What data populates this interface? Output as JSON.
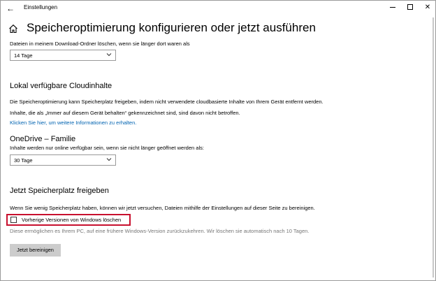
{
  "window": {
    "title": "Einstellungen",
    "back_glyph": "←",
    "minimize_label": "",
    "close_glyph": "✕"
  },
  "page": {
    "title": "Speicheroptimierung konfigurieren oder jetzt ausführen"
  },
  "downloads": {
    "label": "Dateien in meinem Download-Ordner löschen, wenn sie länger dort waren als",
    "selected": "14 Tage"
  },
  "cloud": {
    "heading": "Lokal verfügbare Cloudinhalte",
    "desc1": "Die Speicheroptimierung kann Speicherplatz freigeben, indem nicht verwendete cloudbasierte Inhalte von Ihrem Gerät entfernt werden.",
    "desc2": "Inhalte, die als „Immer auf diesem Gerät behalten“ gekennzeichnet sind, sind davon nicht betroffen.",
    "link": "Klicken Sie hier, um weitere Informationen zu erhalten.",
    "account_heading": "OneDrive – Familie",
    "account_label": "Inhalte werden nur online verfügbar sein, wenn sie nicht länger geöffnet werden als:",
    "selected": "30 Tage"
  },
  "free_now": {
    "heading": "Jetzt Speicherplatz freigeben",
    "desc": "Wenn Sie wenig Speicherplatz haben, können wir jetzt versuchen, Dateien mithilfe der Einstellungen auf dieser Seite zu bereinigen.",
    "checkbox_label": "Vorherige Versionen von Windows löschen",
    "checkbox_checked": false,
    "note": "Diese ermöglichen es Ihrem PC, auf eine frühere Windows-Version zurückzukehren. Wir löschen sie automatisch nach 10 Tagen.",
    "button": "Jetzt bereinigen"
  },
  "colors": {
    "accent_link": "#0063b1",
    "highlight": "#c8102e",
    "button_bg": "#cccccc"
  }
}
